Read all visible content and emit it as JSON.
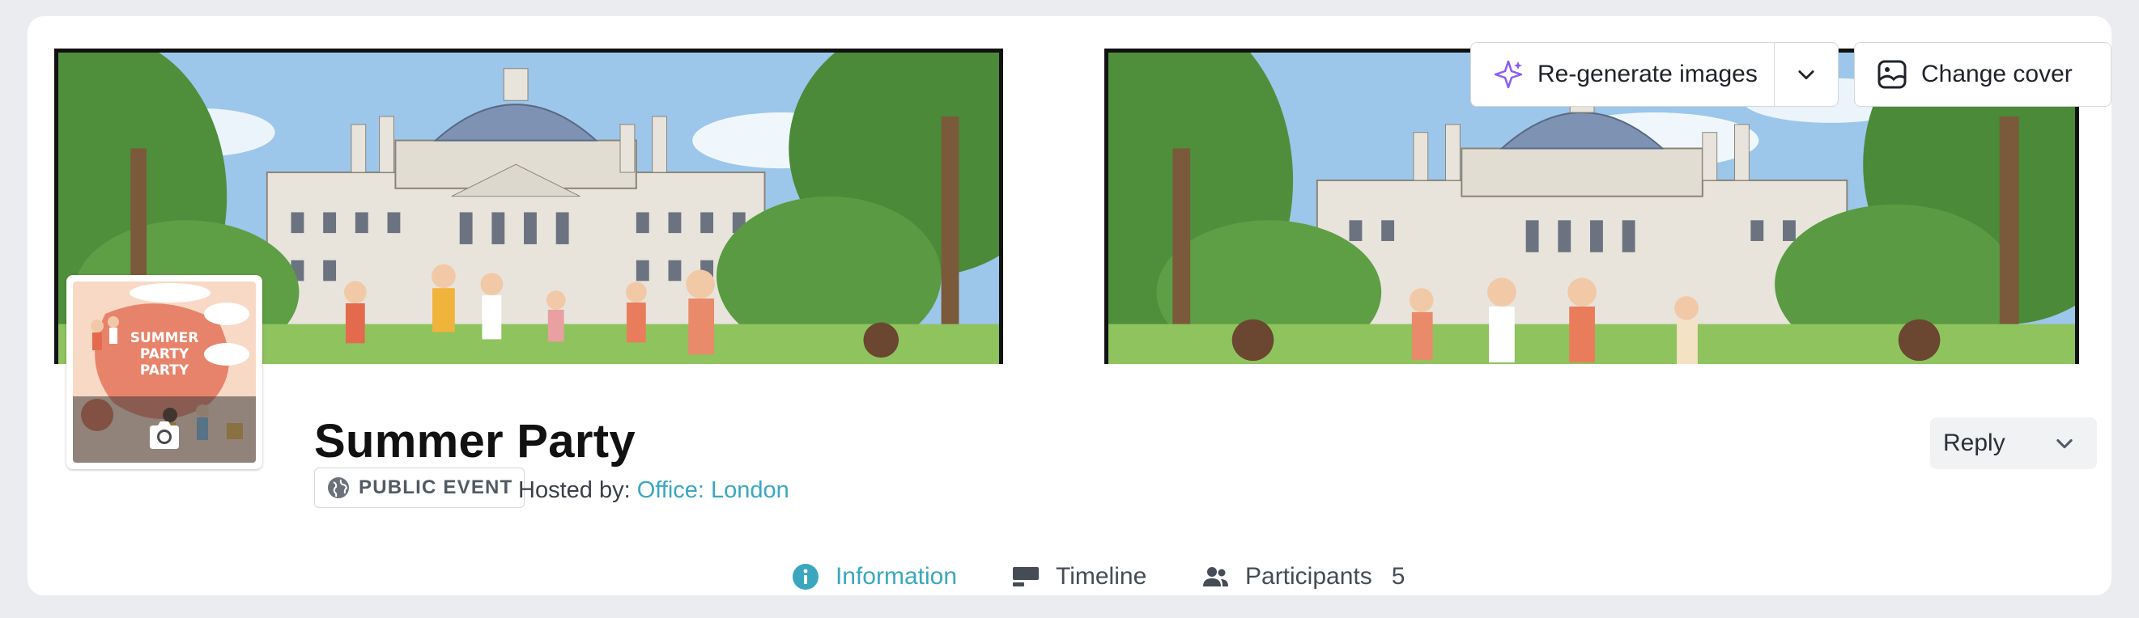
{
  "event": {
    "title": "Summer Party",
    "visibility": "PUBLIC EVENT",
    "hosted_by_label": "Hosted by:",
    "host": "Office: London",
    "poster_text": "SUMMER PARTY PARTY"
  },
  "cover_controls": {
    "regenerate_label": "Re-generate images",
    "change_cover_label": "Change cover"
  },
  "reply": {
    "label": "Reply"
  },
  "tabs": [
    {
      "label": "Information",
      "active": true
    },
    {
      "label": "Timeline"
    },
    {
      "label": "Participants",
      "count": "5"
    }
  ],
  "colors": {
    "accent": "#3aa7bf",
    "background": "#ebecef",
    "sparkle": "#8b5cf6"
  },
  "icons": {
    "regenerate": "sparkle-icon",
    "regenerate_menu": "chevron-down-icon",
    "change_cover": "image-icon",
    "thumbnail_upload": "camera-icon",
    "visibility": "globe-icon",
    "reply_menu": "chevron-down-icon",
    "information": "info-icon",
    "timeline": "timeline-icon",
    "participants": "people-icon"
  }
}
